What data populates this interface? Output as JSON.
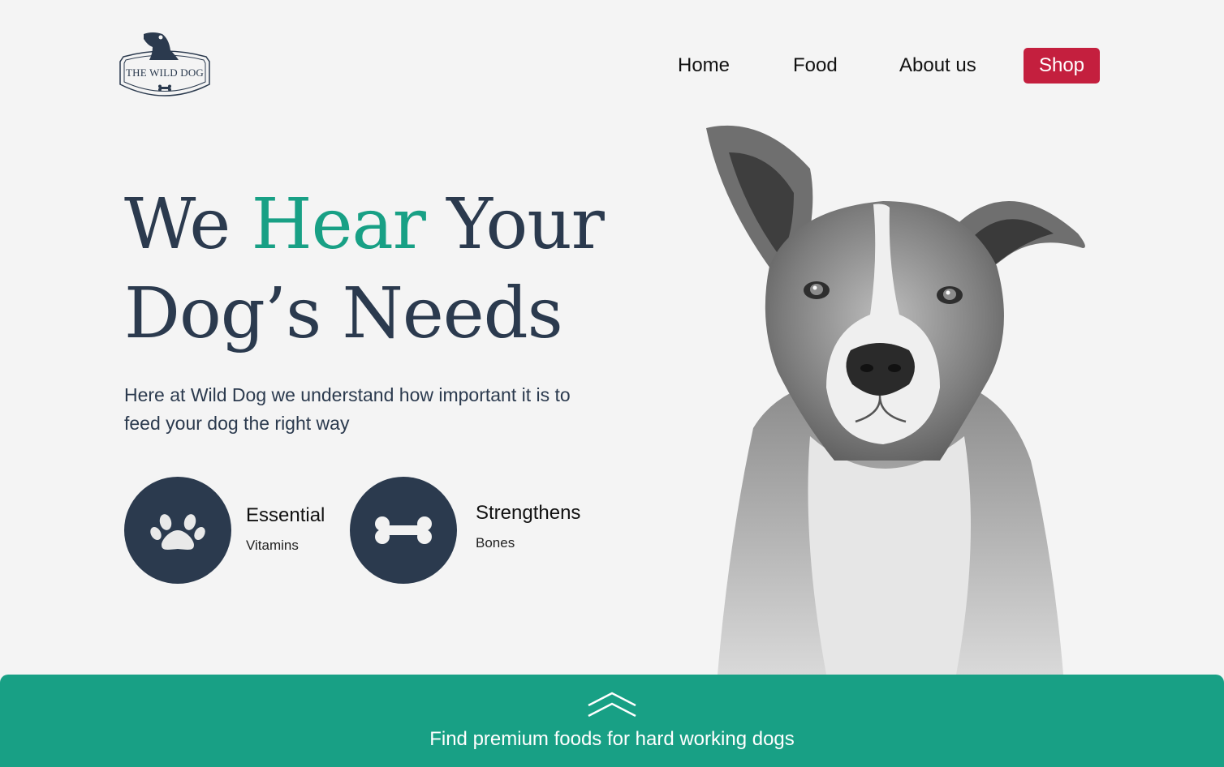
{
  "brand": {
    "logo_text": "THE WILD DOG"
  },
  "nav": {
    "home": "Home",
    "food": "Food",
    "about": "About us",
    "shop": "Shop"
  },
  "hero": {
    "headline_part1": "We ",
    "headline_highlight": "Hear",
    "headline_part2": " Your Dog’s Needs",
    "subtext": "Here at Wild Dog we understand how important it is to feed your dog the right way"
  },
  "features": [
    {
      "title": "Essential",
      "subtitle": "Vitamins",
      "icon": "paw-icon"
    },
    {
      "title": "Strengthens",
      "subtitle": "Bones",
      "icon": "bone-icon"
    }
  ],
  "footer": {
    "text": "Find premium foods for hard working dogs",
    "icon": "chevron-up-icon"
  },
  "colors": {
    "background": "#f4f4f4",
    "navy": "#2b3a4e",
    "accent_green": "#18a085",
    "shop_red": "#c41f3e"
  }
}
